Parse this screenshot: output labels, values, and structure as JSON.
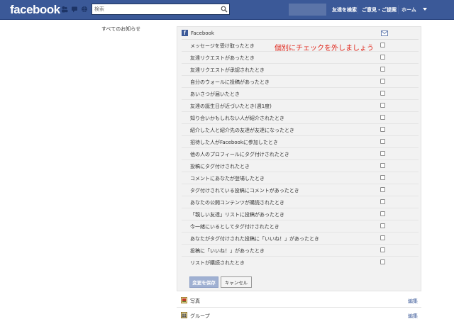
{
  "header": {
    "logo": "facebook",
    "search_placeholder": "検索",
    "nav": [
      "友達を検索",
      "ご意見・ご提案",
      "ホーム"
    ]
  },
  "left": {
    "label": "すべてのお知らせ"
  },
  "panel": {
    "title": "Facebook",
    "annotation": "個別にチェックを外しましょう",
    "items": [
      "メッセージを受け取ったとき",
      "友達リクエストがあったとき",
      "友達リクエストが承認されたとき",
      "自分のウォールに投稿があったとき",
      "あいさつが届いたとき",
      "友達の誕生日が近づいたとき(週1度)",
      "知り合いかもしれない人が紹介されたとき",
      "紹介した人と紹介先の友達が友達になったとき",
      "招待した人がFacebookに参加したとき",
      "他の人のプロフィールにタグ付けされたとき",
      "投稿にタグ付けされたとき",
      "コメントにあなたが登場したとき",
      "タグ付けされている投稿にコメントがあったとき",
      "あなたの公開コンテンツが購読されたとき",
      "「親しい友達」リストに投稿があったとき",
      "今一緒にいるとしてタグ付けされたとき",
      "あなたがタグ付けされた投稿に「いいね！」があったとき",
      "投稿に「いいね！」があったとき",
      "リストが購読されたとき"
    ],
    "save_label": "変更を保存",
    "cancel_label": "キャンセル"
  },
  "sections": [
    {
      "label": "写真",
      "edit": "編集"
    },
    {
      "label": "グループ",
      "edit": "編集"
    }
  ],
  "colors": {
    "brand": "#3b5998",
    "annotation": "#e0271c"
  }
}
